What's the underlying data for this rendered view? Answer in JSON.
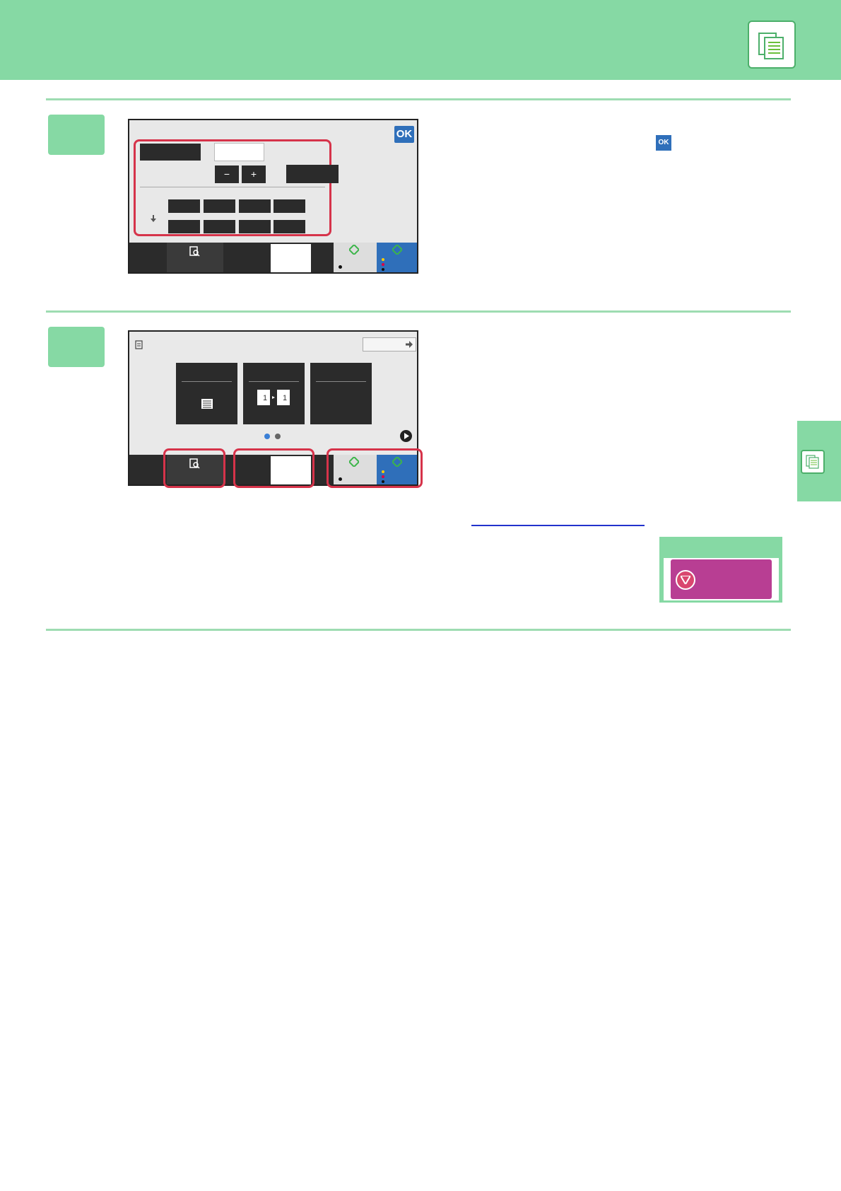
{
  "header": {
    "app_icon": "copy-document-icon"
  },
  "step1": {
    "screen": {
      "ok_label": "OK",
      "minus_label": "−",
      "plus_label": "+"
    },
    "instruction_ok_label": "OK"
  },
  "step2": {
    "screen": {
      "page_dots": 2,
      "active_dot": 1
    }
  },
  "side_tab": {
    "icon": "copy-document-icon"
  },
  "note": {
    "icon": "stop-icon"
  },
  "colors": {
    "header_green": "#86d9a4",
    "highlight_red": "#d6334a",
    "start_blue": "#2f6fba",
    "stop_magenta": "#b83e93"
  }
}
